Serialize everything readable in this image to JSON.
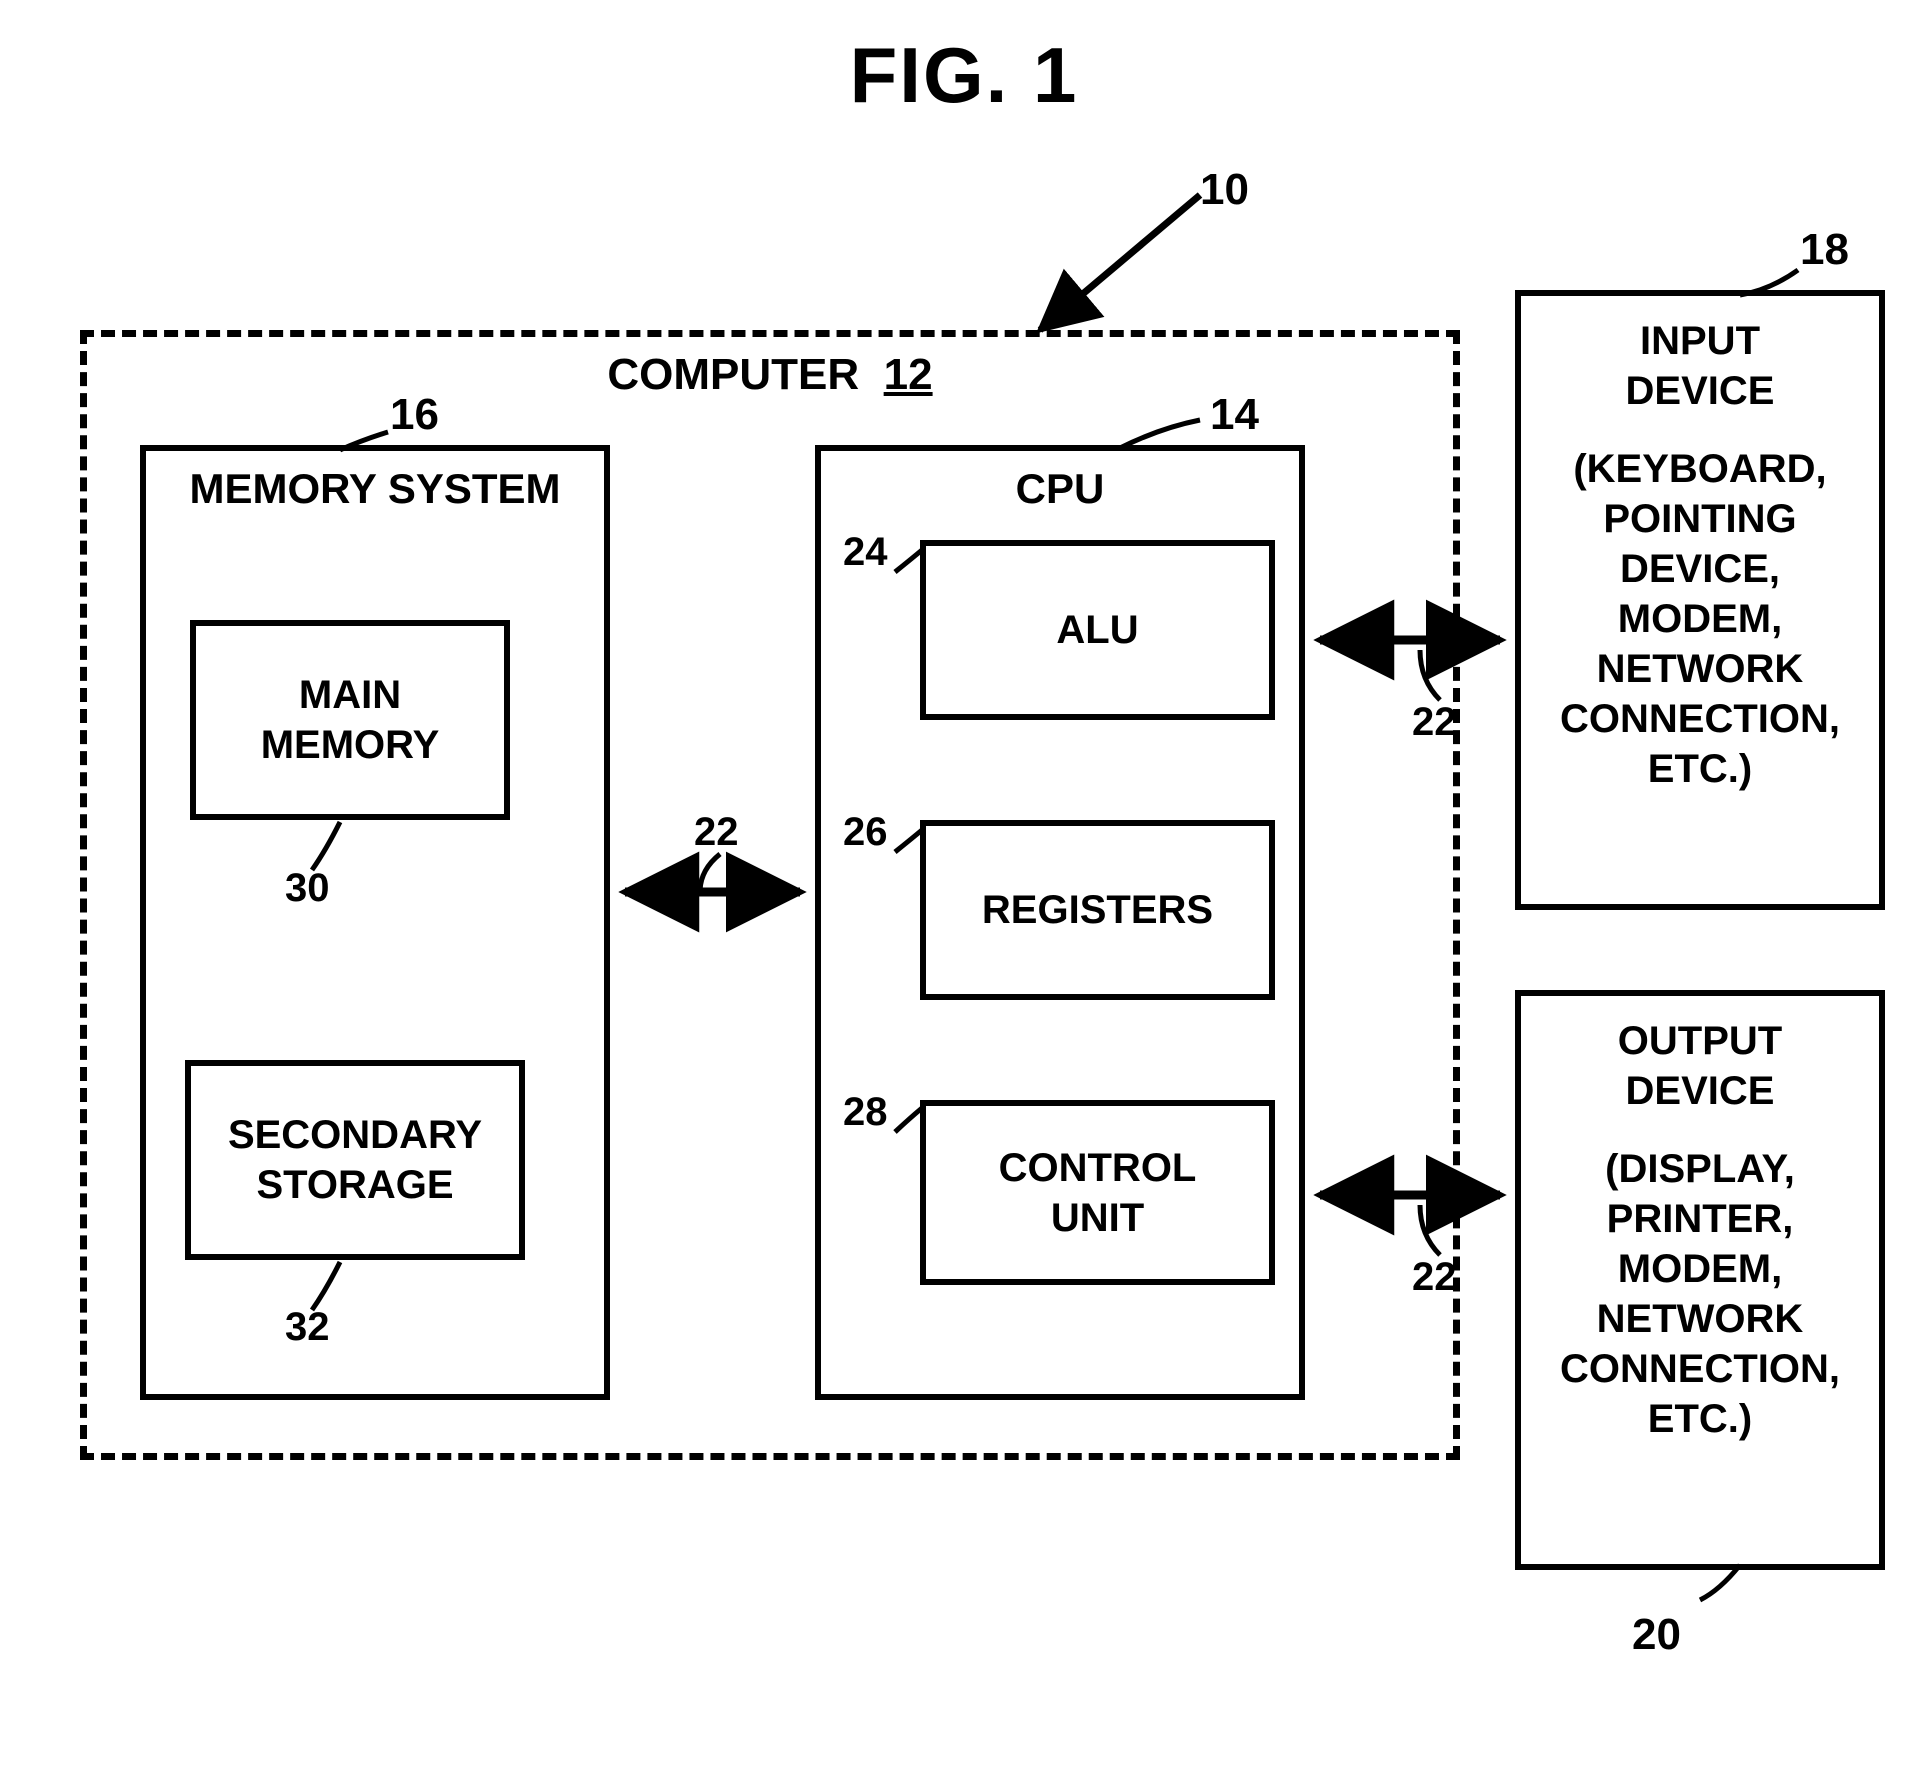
{
  "figure_title": "FIG.  1",
  "refs": {
    "r10": "10",
    "r12_label": "COMPUTER",
    "r12_num": "12",
    "r14": "14",
    "r16": "16",
    "r18": "18",
    "r20": "20",
    "r22": "22",
    "r24": "24",
    "r26": "26",
    "r28": "28",
    "r30": "30",
    "r32": "32"
  },
  "blocks": {
    "memory_system": "MEMORY SYSTEM",
    "main_memory": "MAIN\nMEMORY",
    "secondary_storage": "SECONDARY\nSTORAGE",
    "cpu": "CPU",
    "alu": "ALU",
    "registers": "REGISTERS",
    "control_unit": "CONTROL\nUNIT",
    "input_title": "INPUT\nDEVICE",
    "input_body": "(KEYBOARD,\nPOINTING\nDEVICE,\nMODEM,\nNETWORK\nCONNECTION,\nETC.)",
    "output_title": "OUTPUT\nDEVICE",
    "output_body": "(DISPLAY,\nPRINTER,\nMODEM,\nNETWORK\nCONNECTION,\nETC.)"
  }
}
